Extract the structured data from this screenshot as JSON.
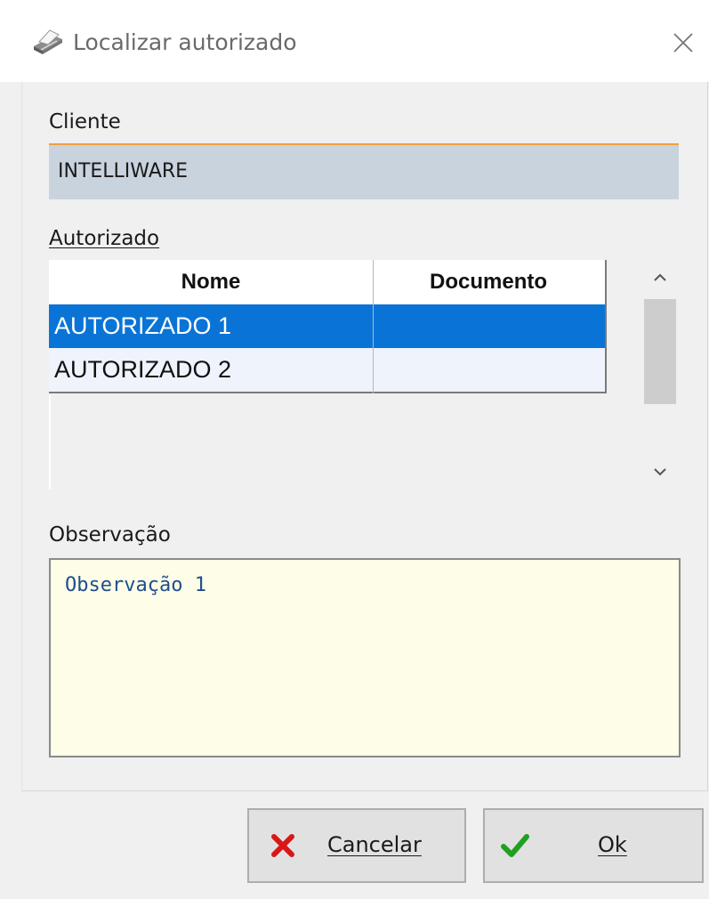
{
  "window": {
    "title": "Localizar autorizado",
    "title_icon": "printer-icon",
    "close_icon": "close-icon"
  },
  "cliente": {
    "label": "Cliente",
    "value": "INTELLIWARE"
  },
  "autorizado": {
    "label": "Autorizado",
    "columns": [
      "Nome",
      "Documento"
    ],
    "rows": [
      {
        "nome": "AUTORIZADO 1",
        "documento": "",
        "selected": true
      },
      {
        "nome": "AUTORIZADO 2",
        "documento": "",
        "selected": false
      }
    ],
    "scrollbar": {
      "up_icon": "chevron-up-icon",
      "down_icon": "chevron-down-icon"
    }
  },
  "observacao": {
    "label": "Observação",
    "value": "Observação 1"
  },
  "buttons": {
    "cancel": {
      "label": "Cancelar",
      "icon": "red-x-icon"
    },
    "ok": {
      "label": "Ok",
      "icon": "green-check-icon"
    }
  },
  "colors": {
    "selection": "#0a74d6",
    "client_field": "#c8d3de",
    "client_field_accent": "#f0a040",
    "observation_bg": "#fdfde8",
    "observation_text": "#1f4f8a"
  }
}
